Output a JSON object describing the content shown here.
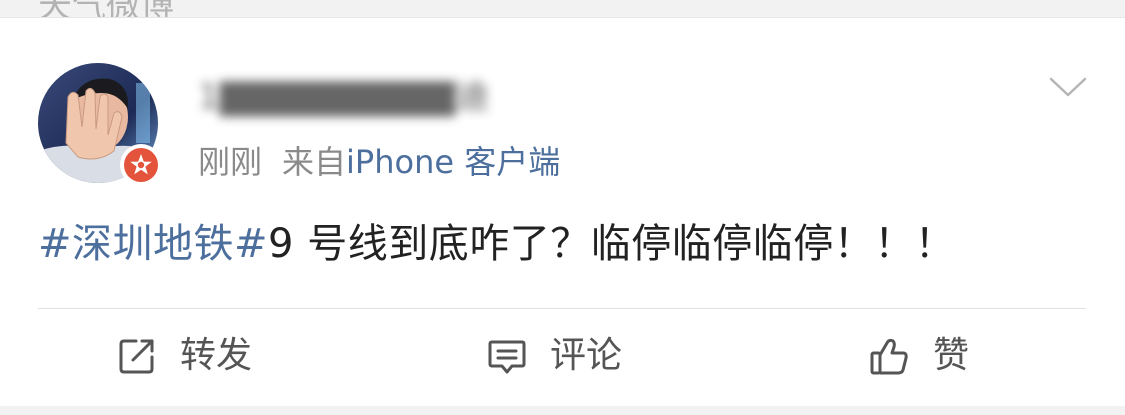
{
  "top_strip": {
    "text": "天气微博"
  },
  "post": {
    "username": "1▇▇▇▇▇▇▇▇▇迪",
    "time": "刚刚",
    "source_prefix": "来自",
    "source": "iPhone 客户端",
    "hashtag": "#深圳地铁#",
    "body": "9 号线到底咋了？临停临停临停！！！"
  },
  "actions": {
    "repost": "转发",
    "comment": "评论",
    "like": "赞"
  },
  "colors": {
    "link_blue": "#4d6f9d",
    "badge_red": "#e4533b",
    "meta_gray": "#8a8a8a"
  },
  "icons": {
    "more": "chevron-down-icon",
    "verified": "verified-badge-icon",
    "repost": "repost-icon",
    "comment": "comment-icon",
    "like": "thumbs-up-icon"
  }
}
